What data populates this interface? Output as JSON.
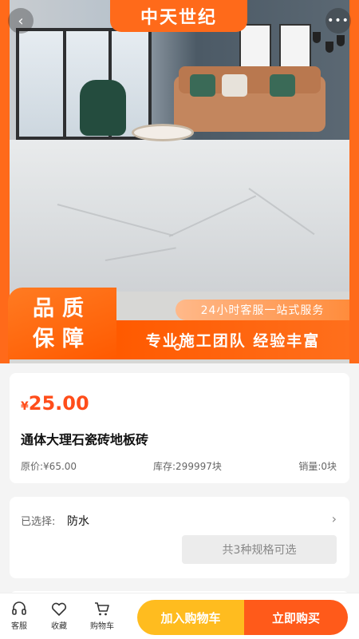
{
  "header": {
    "back_icon": "chevron-left-icon",
    "more_icon": "more-dots-icon",
    "brand": "中天世纪"
  },
  "banner": {
    "quality_line1": "品质",
    "quality_line2": "保障",
    "service": "24小时客服一站式服务",
    "slogan": "专业施工团队 经验丰富",
    "accent": "#ff6a1a"
  },
  "product": {
    "currency": "¥",
    "price": "25.00",
    "title": "通体大理石瓷砖地板砖",
    "original_price": "原价:¥65.00",
    "stock": "库存:299997块",
    "sales": "销量:0块",
    "price_color": "#ff4d1a"
  },
  "spec": {
    "selected_label": "已选择:",
    "selected_value": "防水",
    "options_button": "共3种规格可选"
  },
  "bottom_bar": {
    "service_label": "客服",
    "favorite_label": "收藏",
    "cart_label": "购物车",
    "add_to_cart": "加入购物车",
    "buy_now": "立即购买",
    "cart_button_color": "#ffbc1f",
    "buy_button_color": "#ff5a1a"
  }
}
